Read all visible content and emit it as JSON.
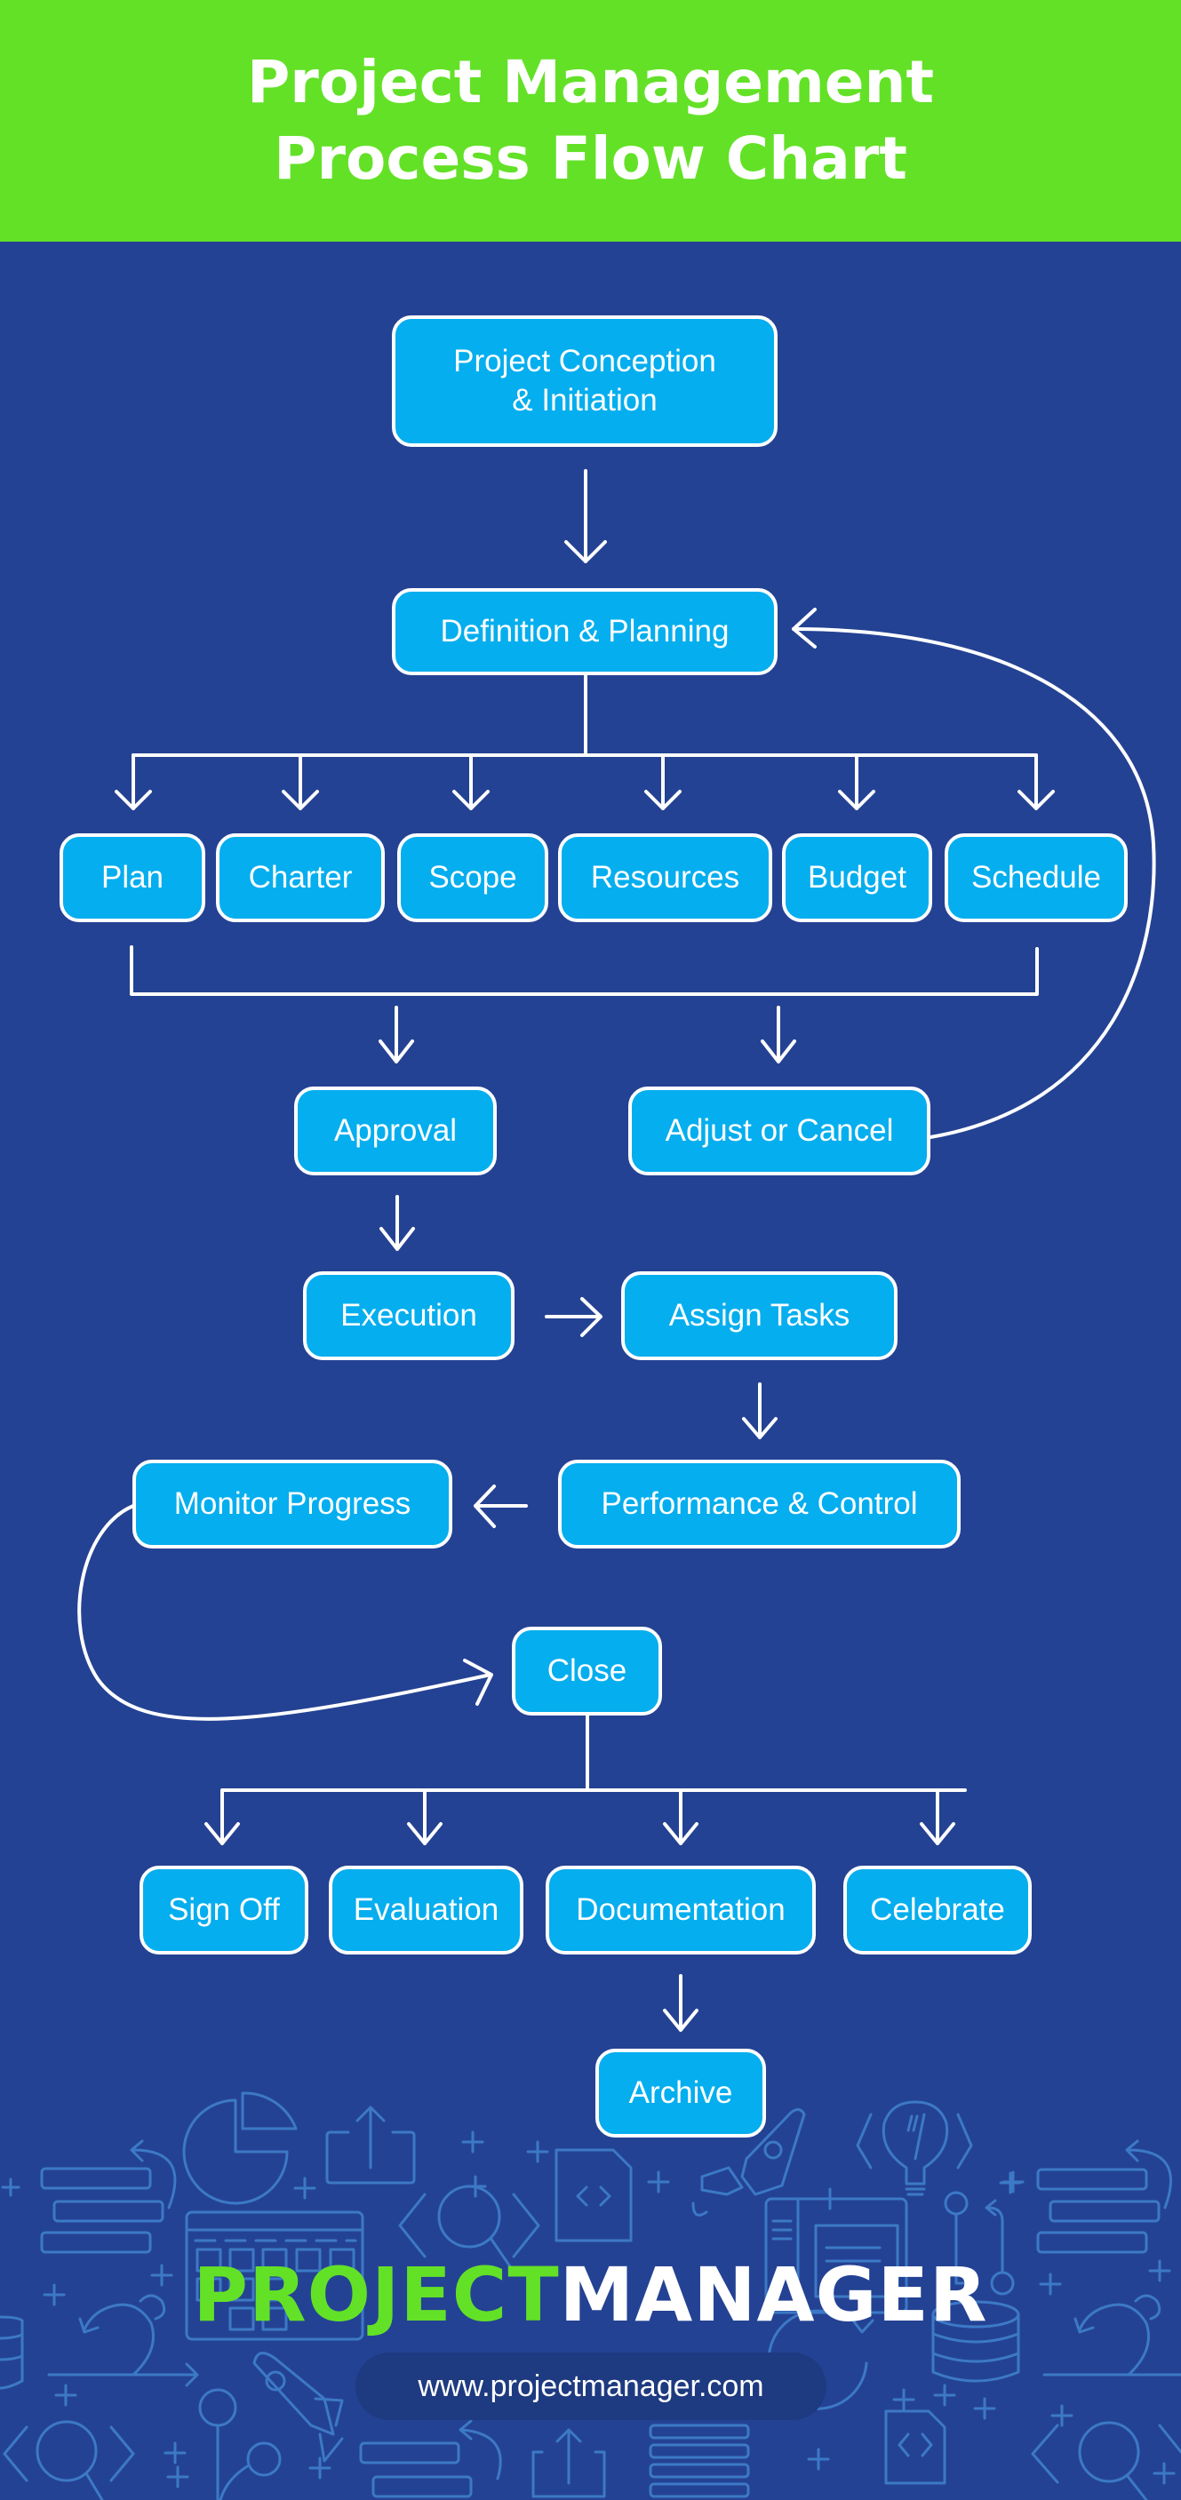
{
  "header": {
    "title_line1": "Project Management",
    "title_line2": "Process Flow Chart"
  },
  "colors": {
    "header_green": "#63E127",
    "background_blue": "#244293",
    "node_fill": "#05AEEE",
    "node_border": "#FFFFFF",
    "connector": "#FFFFFF",
    "pattern_icon": "#3C79C6",
    "url_pill": "#1E3A80"
  },
  "flow": {
    "initiation": {
      "line1": "Project Conception",
      "line2": "& Initiation"
    },
    "planning": "Definition & Planning",
    "planning_items": [
      "Plan",
      "Charter",
      "Scope",
      "Resources",
      "Budget",
      "Schedule"
    ],
    "approval": "Approval",
    "adjust": "Adjust or Cancel",
    "execution": "Execution",
    "assign": "Assign Tasks",
    "performance": "Performance & Control",
    "monitor": "Monitor Progress",
    "close": "Close",
    "close_items": [
      "Sign Off",
      "Evaluation",
      "Documentation",
      "Celebrate"
    ],
    "archive": "Archive"
  },
  "edges": [
    {
      "from": "Project Conception & Initiation",
      "to": "Definition & Planning"
    },
    {
      "from": "Definition & Planning",
      "to": [
        "Plan",
        "Charter",
        "Scope",
        "Resources",
        "Budget",
        "Schedule"
      ]
    },
    {
      "from": [
        "Plan",
        "Charter",
        "Scope",
        "Resources",
        "Budget",
        "Schedule"
      ],
      "to": [
        "Approval",
        "Adjust or Cancel"
      ]
    },
    {
      "from": "Adjust or Cancel",
      "to": "Definition & Planning",
      "style": "curved-loop"
    },
    {
      "from": "Approval",
      "to": "Execution"
    },
    {
      "from": "Execution",
      "to": "Assign Tasks"
    },
    {
      "from": "Assign Tasks",
      "to": "Performance & Control"
    },
    {
      "from": "Performance & Control",
      "to": "Monitor Progress"
    },
    {
      "from": "Monitor Progress",
      "to": "Close",
      "style": "curved"
    },
    {
      "from": "Close",
      "to": [
        "Sign Off",
        "Evaluation",
        "Documentation",
        "Celebrate"
      ]
    },
    {
      "from": "Documentation",
      "to": "Archive"
    }
  ],
  "footer": {
    "brand_part1": "PROJECT",
    "brand_part2": "MANAGER",
    "url": "www.projectmanager.com",
    "pattern_icons": [
      "pie-chart-icon",
      "upload-icon",
      "code-file-icon",
      "rocket-icon",
      "lightbulb-icon",
      "list-bars-icon",
      "calendar-icon",
      "magnifier-icon",
      "database-icon",
      "loop-arrow-icon",
      "git-branch-icon",
      "plus-icon"
    ]
  }
}
